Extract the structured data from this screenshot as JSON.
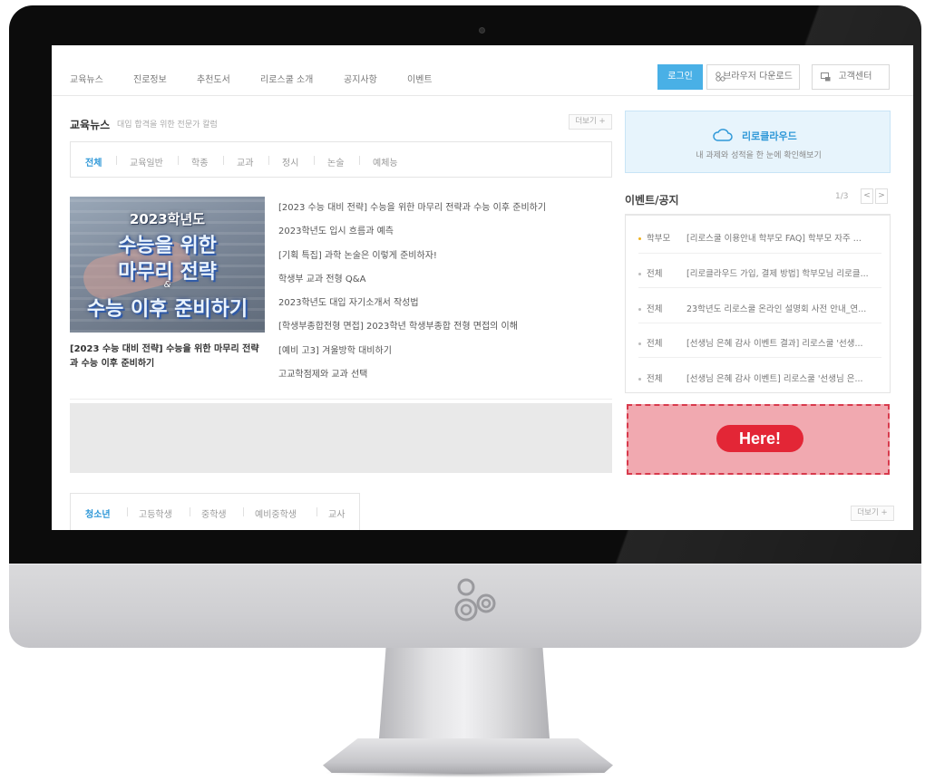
{
  "nav": {
    "items": [
      "교육뉴스",
      "진로정보",
      "추천도서",
      "리로스쿨 소개",
      "공지사항",
      "이벤트"
    ],
    "login_label": "로그인",
    "browser_download_label": "브라우저 다운로드",
    "customer_center_label": "고객센터"
  },
  "news": {
    "title": "교육뉴스",
    "subtitle": "대입 합격을 위한 전문가 칼럼",
    "more_label": "더보기 +",
    "tabs": [
      "전체",
      "교육일반",
      "학종",
      "교과",
      "정시",
      "논술",
      "예체능"
    ],
    "active_tab": "전체",
    "featured": {
      "image_text": [
        "2023학년도",
        "수능을 위한",
        "마무리 전략",
        "&",
        "수능 이후 준비하기"
      ],
      "caption": "[2023 수능 대비 전략] 수능을 위한 마무리 전략과 수능 이후 준비하기"
    },
    "items": [
      "[2023 수능 대비 전략] 수능을 위한 마무리 전략과 수능 이후 준비하기",
      "2023학년도 입시 흐름과 예측",
      "[기획 특집] 과학 논술은 이렇게 준비하자!",
      "학생부 교과 전형 Q&A",
      "2023학년도 대입 자기소개서 작성법",
      "[학생부종합전형 면접] 2023학년 학생부종합 전형 면접의 이해",
      "[예비 고3] 겨울방학 대비하기",
      "고교학점제와 교과 선택"
    ]
  },
  "bottom_tabs": {
    "tabs": [
      "청소년",
      "고등학생",
      "중학생",
      "예비중학생",
      "교사"
    ],
    "active_tab": "청소년",
    "more_label": "더보기 +"
  },
  "cloud": {
    "title": "리로클라우드",
    "subtitle": "내 과제와 성적을 한 눈에 확인해보기"
  },
  "events": {
    "title": "이벤트/공지",
    "pager": "1/3",
    "prev_label": "<",
    "next_label": ">",
    "items": [
      {
        "category": "학부모",
        "text": "[리로스쿨 이용안내 학부모 FAQ] 학부모 자주 ...",
        "highlight": true
      },
      {
        "category": "전체",
        "text": "[리로클라우드 가입, 결제 방법] 학부모님 리로클...",
        "highlight": false
      },
      {
        "category": "전체",
        "text": "23학년도 리로스쿨 온라인 설명회 사전 안내_연...",
        "highlight": false
      },
      {
        "category": "전체",
        "text": "[선생님 은혜 감사 이벤트 결과] 리로스쿨 '선생...",
        "highlight": false
      },
      {
        "category": "전체",
        "text": "[선생님 은혜 감사 이벤트] 리로스쿨 '선생님 은...",
        "highlight": false
      }
    ]
  },
  "callout": {
    "label": "Here!",
    "color": "#e32636"
  },
  "colors": {
    "accent": "#49b0e6",
    "tab_active": "#2f98d8",
    "highlight_dot": "#f0b21e",
    "callout_fill": "#f1a9b0"
  }
}
